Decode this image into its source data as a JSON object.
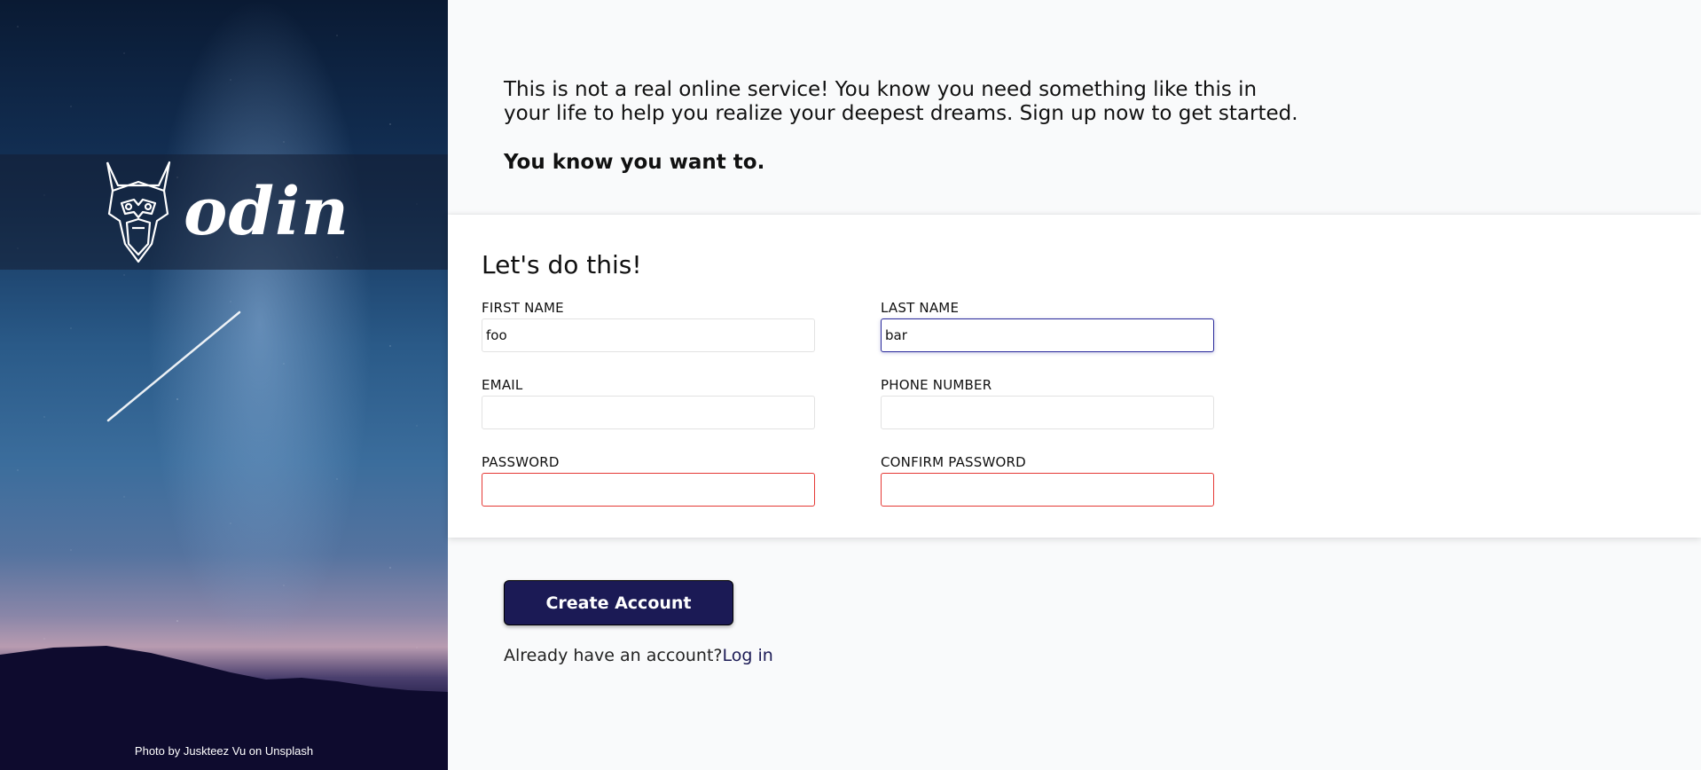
{
  "hero": {
    "logo_text": "odin",
    "logo_icon": "viking-helmet-icon",
    "photo_credit": "Photo by Juskteez Vu on Unsplash"
  },
  "intro": {
    "paragraph": "This is not a real online service! You know you need something like this in your life to help you realize your deepest dreams. Sign up now to get started.",
    "tagline": "You know you want to."
  },
  "form": {
    "title": "Let's do this!",
    "fields": {
      "first_name": {
        "label": "FIRST NAME",
        "value": "foo"
      },
      "last_name": {
        "label": "LAST NAME",
        "value": "bar"
      },
      "email": {
        "label": "EMAIL",
        "value": ""
      },
      "phone": {
        "label": "PHONE NUMBER",
        "value": ""
      },
      "password": {
        "label": "PASSWORD",
        "value": ""
      },
      "confirm_password": {
        "label": "CONFIRM PASSWORD",
        "value": ""
      }
    }
  },
  "actions": {
    "create_account_label": "Create Account",
    "login_prompt": "Already have an account?",
    "login_link": "Log in"
  },
  "colors": {
    "button_bg": "#1b1a55",
    "focus_border": "#2a2a9c",
    "invalid_border": "#e53935",
    "page_bg": "#f9fafb"
  }
}
